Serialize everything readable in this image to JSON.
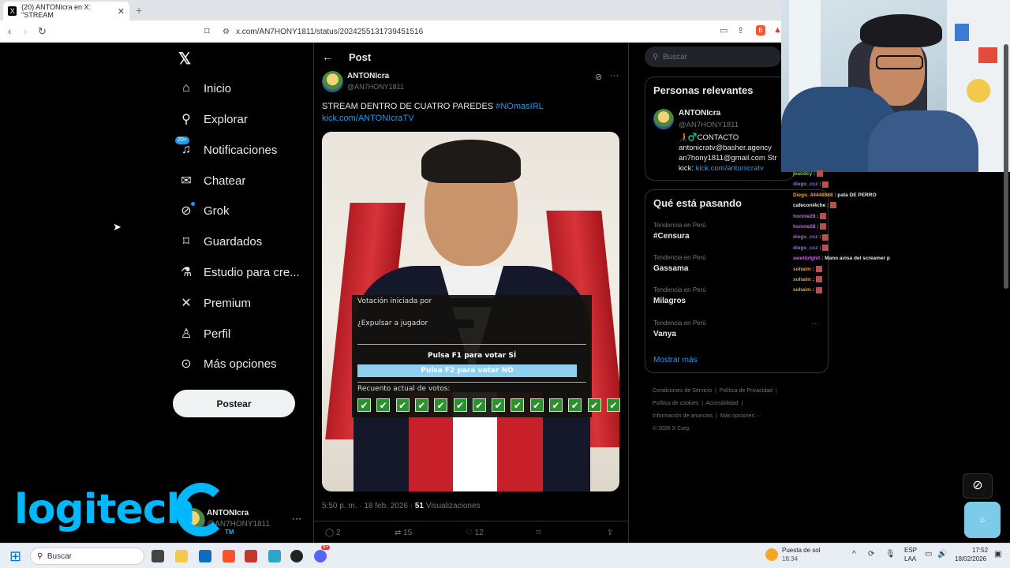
{
  "browser": {
    "tab_title": "(20) ANTONIcra en X: \"STREAM",
    "url": "x.com/AN7HONY1811/status/2024255131739451516"
  },
  "sidebar": {
    "items": [
      {
        "label": "Inicio",
        "icon": "home-icon"
      },
      {
        "label": "Explorar",
        "icon": "search-icon"
      },
      {
        "label": "Notificaciones",
        "icon": "bell-icon",
        "badge": "20+"
      },
      {
        "label": "Chatear",
        "icon": "mail-icon"
      },
      {
        "label": "Grok",
        "icon": "grok-icon"
      },
      {
        "label": "Guardados",
        "icon": "bookmark-icon"
      },
      {
        "label": "Estudio para cre...",
        "icon": "flask-icon"
      },
      {
        "label": "Premium",
        "icon": "x-logo-icon"
      },
      {
        "label": "Perfil",
        "icon": "person-icon"
      },
      {
        "label": "Más opciones",
        "icon": "more-circle-icon"
      }
    ],
    "post_button": "Postear",
    "account_name": "ANTONIcra",
    "account_handle": "@AN7HONY1811"
  },
  "post": {
    "header": "Post",
    "author_name": "ANTONIcra",
    "author_handle": "@AN7HONY1811",
    "text": "STREAM DENTRO DE CUATRO PAREDES",
    "hashtag": "#NOmasIRL",
    "link": "kick.com/ANTONIcraTV",
    "time": "5:50 p. m. · 18 feb. 2026 ·",
    "views_count": "51",
    "views_label": "Visualizaciones",
    "replies": "2",
    "reposts": "15",
    "likes": "12",
    "vote_overlay": {
      "line1": "Votación iniciada por",
      "line2": "¿Expulsar a jugador",
      "yes": "Pulsa F1 para votar SÍ",
      "no": "Pulsa F2 para votar NO",
      "count": "Recuento actual de votos:",
      "checks": 14
    }
  },
  "right": {
    "search_placeholder": "Buscar",
    "relevant_title": "Personas relevantes",
    "rel_name": "ANTONIcra",
    "rel_handle": "@AN7HONY1811",
    "rel_bio1": "🧑‍🦯‍♂️CONTACTO",
    "rel_bio2": "antonicratv@basher.agency",
    "rel_bio3": "an7hony1811@gmail.com Str",
    "rel_bio4_prefix": "kick:",
    "rel_bio4_link": "kick.com/antonicratv",
    "trends_title": "Qué está pasando",
    "trends": [
      {
        "sub": "Tendencia en Perú",
        "name": "#Censura"
      },
      {
        "sub": "Tendencia en Perú",
        "name": "Gassama"
      },
      {
        "sub": "Tendencia en Perú",
        "name": "Milagros"
      },
      {
        "sub": "Tendencia en Perú",
        "name": "Vanya"
      }
    ],
    "show_more": "Mostrar más",
    "footer1": [
      "Condiciones de Servicio",
      "Política de Privacidad"
    ],
    "footer2": [
      "Política de cookies",
      "Accesibilidad"
    ],
    "footer3": [
      "Información de anuncios",
      "Más opciones ···"
    ],
    "copyright": "© 2026 X Corp."
  },
  "chat": [
    {
      "user": "jeandcy",
      "msg": "",
      "color": "#7ec85a"
    },
    {
      "user": "diego_ccz",
      "msg": "",
      "color": "#9b6ae0"
    },
    {
      "user": "Diego_44448888",
      "msg": "pata DE PERRO",
      "color": "#e8a23a"
    },
    {
      "user": "cafeconl4che",
      "msg": "",
      "color": "#e7e9ea"
    },
    {
      "user": "honnie28",
      "msg": "",
      "color": "#c06be0"
    },
    {
      "user": "honnie28",
      "msg": "",
      "color": "#c06be0"
    },
    {
      "user": "diego_ccz",
      "msg": "",
      "color": "#9b6ae0"
    },
    {
      "user": "diego_ccz",
      "msg": "",
      "color": "#9b6ae0"
    },
    {
      "user": "awetlofghit",
      "msg": "Mano avisa del screamer p",
      "color": "#c06be0"
    },
    {
      "user": "sohaim",
      "msg": "",
      "color": "#e8a23a"
    },
    {
      "user": "sohaim",
      "msg": "",
      "color": "#e8a23a"
    },
    {
      "user": "sohaim",
      "msg": "",
      "color": "#e8a23a"
    }
  ],
  "overlay": {
    "brand": "logitech",
    "tm": "TM"
  },
  "taskbar": {
    "search": "Buscar",
    "weather_title": "Puesta de sol",
    "weather_time": "18:34",
    "lang1": "ESP",
    "lang2": "LAA",
    "time": "17:52",
    "date": "18/02/2026",
    "discord_badge": "9+"
  },
  "colors": {
    "accent": "#1d9bf0",
    "bg": "#000000",
    "logitech": "#00b8fc"
  }
}
